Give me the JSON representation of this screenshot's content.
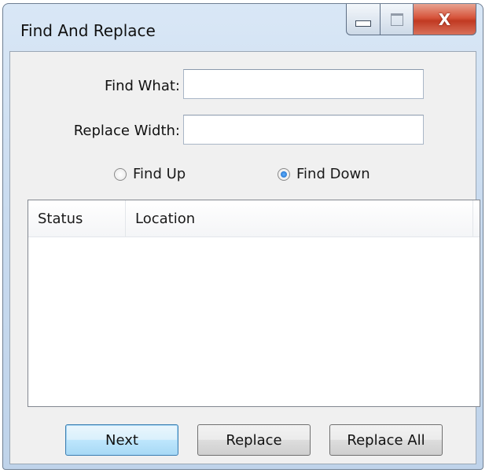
{
  "window": {
    "title": "Find And Replace",
    "minimize_label": "",
    "maximize_label": "",
    "close_label": "X"
  },
  "form": {
    "find_label": "Find What:",
    "find_value": "",
    "replace_label": "Replace Width:",
    "replace_value": ""
  },
  "direction": {
    "up_label": "Find Up",
    "down_label": "Find Down",
    "selected": "down"
  },
  "results": {
    "columns": [
      "Status",
      "Location"
    ],
    "rows": []
  },
  "buttons": {
    "next": "Next",
    "replace": "Replace",
    "replace_all": "Replace All"
  }
}
